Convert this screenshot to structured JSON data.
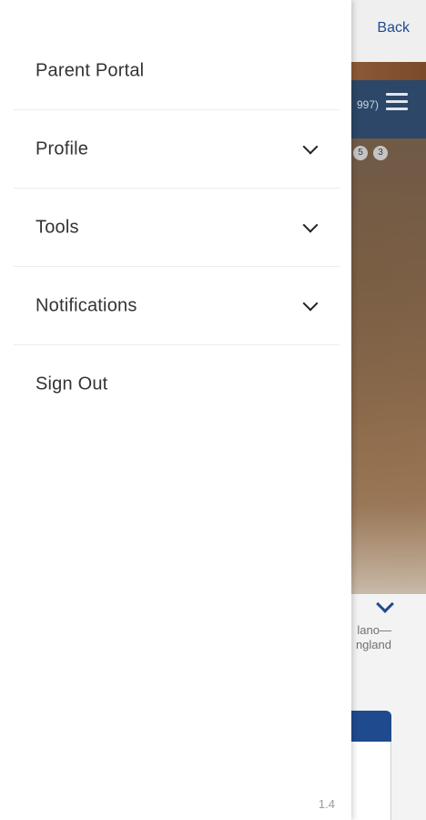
{
  "background": {
    "back_label": "Back",
    "header_partial_text": "997)",
    "badges": [
      "5",
      "3"
    ],
    "caption_line1": "lano—",
    "caption_line2": "ngland"
  },
  "drawer": {
    "items": [
      {
        "label": "Parent Portal",
        "has_chevron": false
      },
      {
        "label": "Profile",
        "has_chevron": true,
        "icon": "chevron-down-icon"
      },
      {
        "label": "Tools",
        "has_chevron": true,
        "icon": "chevron-down-icon"
      },
      {
        "label": "Notifications",
        "has_chevron": true,
        "icon": "chevron-down-icon"
      },
      {
        "label": "Sign Out",
        "has_chevron": false
      }
    ],
    "version": "1.4"
  },
  "colors": {
    "brand_blue": "#1f4b8e",
    "header_navy": "#2c4767",
    "menu_text": "#333333"
  }
}
